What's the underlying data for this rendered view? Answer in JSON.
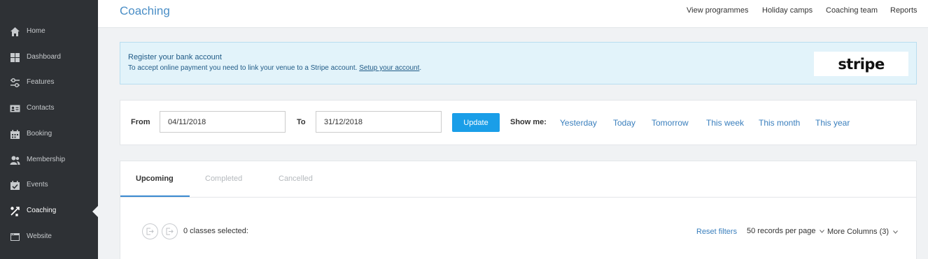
{
  "sidebar": {
    "items": [
      {
        "label": "Home",
        "icon": "home-icon"
      },
      {
        "label": "Dashboard",
        "icon": "dashboard-icon"
      },
      {
        "label": "Features",
        "icon": "sliders-icon"
      },
      {
        "label": "Contacts",
        "icon": "contact-card-icon"
      },
      {
        "label": "Booking",
        "icon": "calendar-icon"
      },
      {
        "label": "Membership",
        "icon": "users-icon"
      },
      {
        "label": "Events",
        "icon": "calendar-check-icon"
      },
      {
        "label": "Coaching",
        "icon": "coaching-icon"
      },
      {
        "label": "Website",
        "icon": "browser-icon"
      }
    ],
    "active": "Coaching"
  },
  "header": {
    "title": "Coaching",
    "nav": [
      "View programmes",
      "Holiday camps",
      "Coaching team",
      "Reports"
    ]
  },
  "banner": {
    "title": "Register your bank account",
    "text": "To accept online payment you need to link your venue to a Stripe account.",
    "link": "Setup your account",
    "trail": ".",
    "logo": "stripe"
  },
  "filters": {
    "from_label": "From",
    "from_value": "04/11/2018",
    "to_label": "To",
    "to_value": "31/12/2018",
    "update_label": "Update",
    "show_me_label": "Show me:",
    "quick": [
      "Yesterday",
      "Today",
      "Tomorrow",
      "This week",
      "This month",
      "This year"
    ]
  },
  "tabs": {
    "items": [
      "Upcoming",
      "Completed",
      "Cancelled"
    ],
    "active": "Upcoming"
  },
  "list": {
    "selected_text": "0 classes selected:",
    "reset_filters": "Reset filters",
    "records_per_page": "50 records per page",
    "more_columns": "More Columns (3)"
  },
  "colors": {
    "sidebar_bg": "#2e3135",
    "accent": "#1a9ee8",
    "link": "#3a7fbd",
    "banner_bg": "#e2f3fa"
  }
}
